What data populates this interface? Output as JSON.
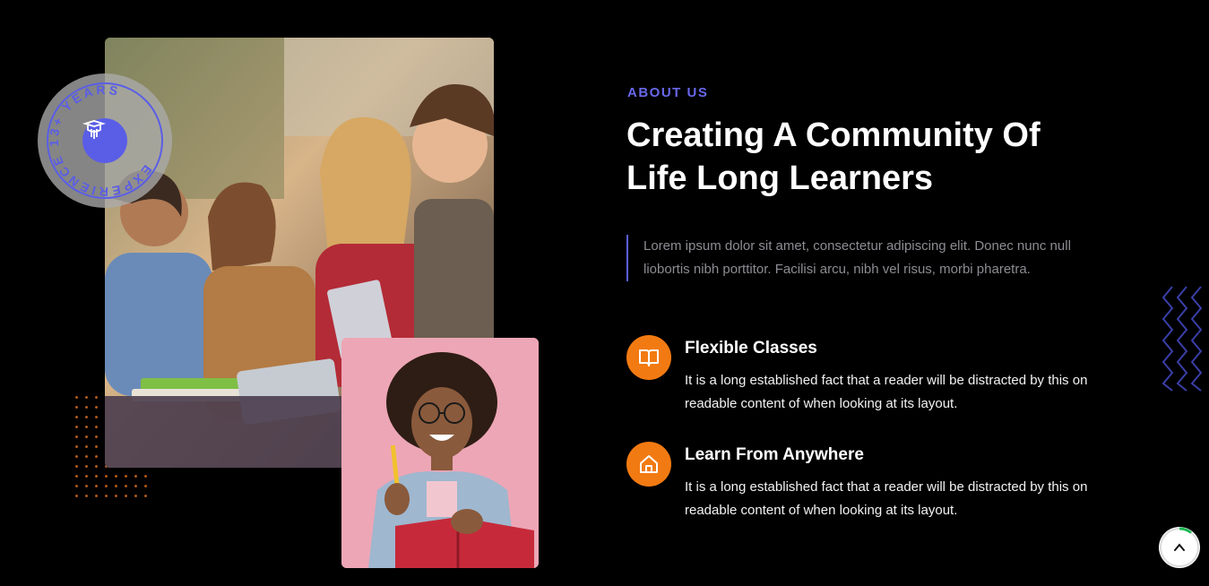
{
  "about": {
    "eyebrow": "ABOUT US",
    "headline_line1": "Creating A Community Of",
    "headline_line2": "Life Long Learners",
    "description": "Lorem ipsum dolor sit amet, consectetur adipiscing elit. Donec nunc null liobortis nibh porttitor. Facilisi arcu, nibh vel risus, morbi pharetra."
  },
  "badge": {
    "text": "EXPERIENCE 13+ YEARS",
    "icon": "graduation-cap-icon"
  },
  "features": [
    {
      "icon": "book-open-icon",
      "title": "Flexible Classes",
      "description": "It is a long established fact that a reader will be distracted by this on readable content of when looking at its layout."
    },
    {
      "icon": "home-icon",
      "title": "Learn From Anywhere",
      "description": "It is a long established fact that a reader will be distracted by this on readable content of when looking at its layout."
    }
  ],
  "colors": {
    "accent_purple": "#5a5ee6",
    "accent_orange": "#f27a12",
    "background": "#000000"
  }
}
